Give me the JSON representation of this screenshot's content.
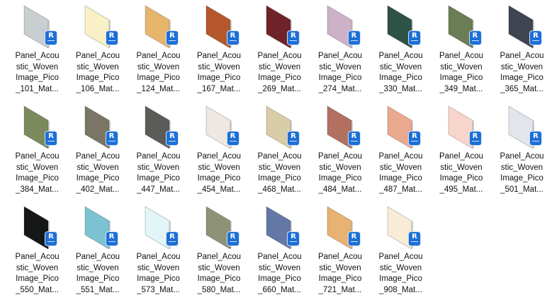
{
  "files": [
    {
      "color": "#c9ced0",
      "lines": [
        "Panel_Acou",
        "stic_Woven",
        "Image_Pico",
        "_101_Mat..."
      ]
    },
    {
      "color": "#f9f0c6",
      "lines": [
        "Panel_Acou",
        "stic_Woven",
        "Image_Pico",
        "_106_Mat..."
      ]
    },
    {
      "color": "#e6b66c",
      "lines": [
        "Panel_Acou",
        "stic_Woven",
        "Image_Pico",
        "_124_Mat..."
      ]
    },
    {
      "color": "#b4582c",
      "lines": [
        "Panel_Acou",
        "stic_Woven",
        "Image_Pico",
        "_167_Mat..."
      ]
    },
    {
      "color": "#6f2228",
      "lines": [
        "Panel_Acou",
        "stic_Woven",
        "Image_Pico",
        "_269_Mat..."
      ]
    },
    {
      "color": "#cdb1c6",
      "lines": [
        "Panel_Acou",
        "stic_Woven",
        "Image_Pico",
        "_274_Mat..."
      ]
    },
    {
      "color": "#2e5246",
      "lines": [
        "Panel_Acou",
        "stic_Woven",
        "Image_Pico",
        "_330_Mat..."
      ]
    },
    {
      "color": "#6a7d55",
      "lines": [
        "Panel_Acou",
        "stic_Woven",
        "Image_Pico",
        "_349_Mat..."
      ]
    },
    {
      "color": "#3e4450",
      "lines": [
        "Panel_Acou",
        "stic_Woven",
        "Image_Pico",
        "_365_Mat..."
      ]
    },
    {
      "color": "#7b8a5d",
      "lines": [
        "Panel_Acou",
        "stic_Woven",
        "Image_Pico",
        "_384_Mat..."
      ]
    },
    {
      "color": "#7b7567",
      "lines": [
        "Panel_Acou",
        "stic_Woven",
        "Image_Pico",
        "_402_Mat..."
      ]
    },
    {
      "color": "#5b5b59",
      "lines": [
        "Panel_Acou",
        "stic_Woven",
        "Image_Pico",
        "_447_Mat..."
      ]
    },
    {
      "color": "#efe8e2",
      "lines": [
        "Panel_Acou",
        "stic_Woven",
        "Image_Pico",
        "_454_Mat..."
      ]
    },
    {
      "color": "#d9cda7",
      "lines": [
        "Panel_Acou",
        "stic_Woven",
        "Image_Pico",
        "_468_Mat..."
      ]
    },
    {
      "color": "#b27060",
      "lines": [
        "Panel_Acou",
        "stic_Woven",
        "Image_Pico",
        "_484_Mat..."
      ]
    },
    {
      "color": "#eaa98e",
      "lines": [
        "Panel_Acou",
        "stic_Woven",
        "Image_Pico",
        "_487_Mat..."
      ]
    },
    {
      "color": "#f8d5ca",
      "lines": [
        "Panel_Acou",
        "stic_Woven",
        "Image_Pico",
        "_495_Mat..."
      ]
    },
    {
      "color": "#e2e6ec",
      "lines": [
        "Panel_Acou",
        "stic_Woven",
        "Image_Pico",
        "_501_Mat..."
      ]
    },
    {
      "color": "#151816",
      "lines": [
        "Panel_Acou",
        "stic_Woven",
        "Image_Pico",
        "_550_Mat..."
      ]
    },
    {
      "color": "#7cc2d3",
      "lines": [
        "Panel_Acou",
        "stic_Woven",
        "Image_Pico",
        "_551_Mat..."
      ]
    },
    {
      "color": "#e2f5f8",
      "lines": [
        "Panel_Acou",
        "stic_Woven",
        "Image_Pico",
        "_573_Mat..."
      ]
    },
    {
      "color": "#8e9277",
      "lines": [
        "Panel_Acou",
        "stic_Woven",
        "Image_Pico",
        "_580_Mat..."
      ]
    },
    {
      "color": "#6478a8",
      "lines": [
        "Panel_Acou",
        "stic_Woven",
        "Image_Pico",
        "_660_Mat..."
      ]
    },
    {
      "color": "#e8b272",
      "lines": [
        "Panel_Acou",
        "stic_Woven",
        "Image_Pico",
        "_721_Mat..."
      ]
    },
    {
      "color": "#f8ecd6",
      "lines": [
        "Panel_Acou",
        "stic_Woven",
        "Image_Pico",
        "_908_Mat..."
      ]
    }
  ],
  "badge": {
    "letter": "R",
    "color": "#1d6fd6",
    "icon": "revit-file-icon"
  }
}
